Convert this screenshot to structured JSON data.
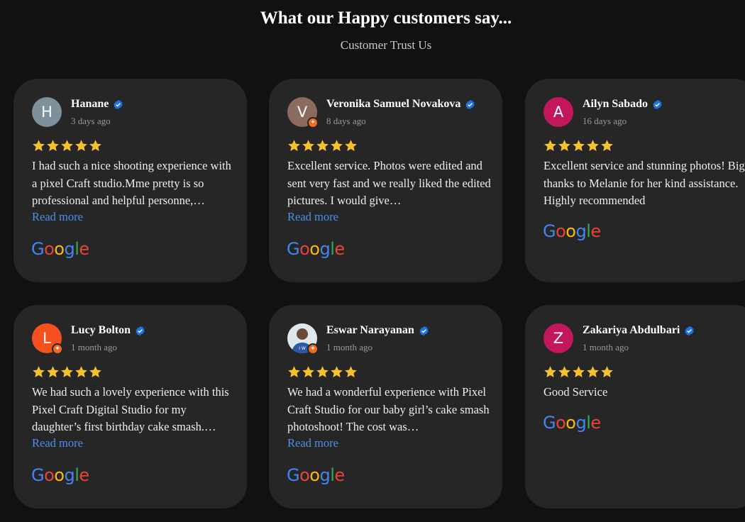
{
  "header": {
    "title": "What our Happy customers say...",
    "subtitle": "Customer Trust Us"
  },
  "colors": {
    "background": "#111111",
    "card": "#262626",
    "star": "#f7c12c",
    "link": "#4b8fe8",
    "verified": "#1d72e8"
  },
  "reviews": [
    {
      "name": "Hanane",
      "time": "3 days ago",
      "avatar_letter": "H",
      "avatar_color": "#7d909c",
      "rating": 5,
      "text": "I had such a nice shooting experience with a pixel Craft studio.Mme pretty is so professional and helpful personne,…",
      "read_more": "Read more",
      "source": "Google"
    },
    {
      "name": "Veronika Samuel Novakova",
      "time": "8 days ago",
      "avatar_letter": "V",
      "avatar_color": "#8c6a5d",
      "rating": 5,
      "text": "Excellent service. Photos were edited and sent very fast and we really liked the edited pictures. I would give…",
      "read_more": "Read more",
      "source": "Google"
    },
    {
      "name": "Ailyn Sabado",
      "time": "16 days ago",
      "avatar_letter": "A",
      "avatar_color": "#c2185b",
      "rating": 5,
      "text": "Excellent service and stunning photos! Big thanks to Melanie for her kind assistance. Highly recommended",
      "read_more": "",
      "source": "Google"
    },
    {
      "name": "Lucy Bolton",
      "time": "1 month ago",
      "avatar_letter": "L",
      "avatar_color": "#f4511e",
      "rating": 5,
      "text": "We had such a lovely experience with this Pixel Craft Digital Studio for my daughter’s first birthday cake smash.…",
      "read_more": "Read more",
      "source": "Google"
    },
    {
      "name": "Eswar Narayanan",
      "time": "1 month ago",
      "avatar_letter": "",
      "avatar_color": "#3b5ea8",
      "rating": 5,
      "text": "We had a wonderful experience with Pixel Craft Studio for our baby girl’s cake smash photoshoot! The cost was…",
      "read_more": "Read more",
      "source": "Google"
    },
    {
      "name": "Zakariya Abdulbari",
      "time": "1 month ago",
      "avatar_letter": "Z",
      "avatar_color": "#c2185b",
      "rating": 5,
      "text": "Good Service",
      "read_more": "",
      "source": "Google"
    }
  ]
}
